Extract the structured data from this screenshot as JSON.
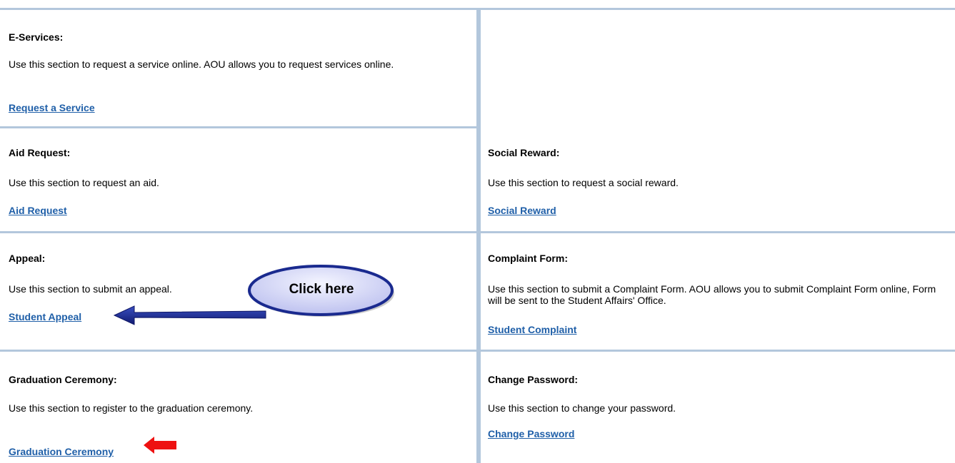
{
  "sections": {
    "eservices": {
      "title": "E-Services:",
      "description": "Use this section to request a service online. AOU allows you to request services online.",
      "link": "Request a Service"
    },
    "aid_request": {
      "title": "Aid Request:",
      "description": "Use this section to request an aid.",
      "link": "Aid Request"
    },
    "social_reward": {
      "title": "Social Reward:",
      "description": "Use this section to request a social reward.",
      "link": "Social Reward"
    },
    "appeal": {
      "title": "Appeal:",
      "description": "Use this section to submit an appeal.",
      "link": "Student Appeal"
    },
    "complaint": {
      "title": "Complaint Form:",
      "description": "Use this section to submit a Complaint Form. AOU allows you to submit Complaint Form online, Form will be sent to the Student Affairs' Office.",
      "link": "Student Complaint"
    },
    "graduation": {
      "title": "Graduation Ceremony:",
      "description": "Use this section to register to the graduation ceremony.",
      "link": "Graduation Ceremony"
    },
    "change_password": {
      "title": "Change Password:",
      "description": "Use this section to change your password.",
      "link": "Change Password"
    }
  },
  "annotation": {
    "callout_text": "Click here"
  },
  "colors": {
    "link": "#1f5fa8",
    "grid": "#b3c7dc",
    "callout_fill": "#d9dcf5",
    "callout_border": "#1a2a8f",
    "blue_arrow": "#1a2a8f",
    "red_arrow": "#ee1111"
  }
}
